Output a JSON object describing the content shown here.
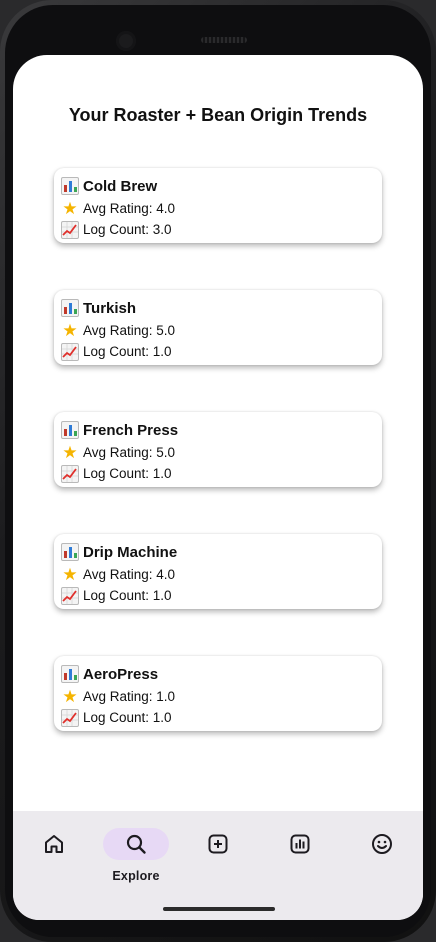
{
  "page": {
    "title": "Your Roaster + Bean Origin Trends"
  },
  "cards": [
    {
      "title": "Cold Brew",
      "rating_text": "Avg Rating: 4.0",
      "count_text": "Log Count: 3.0"
    },
    {
      "title": "Turkish",
      "rating_text": "Avg Rating: 5.0",
      "count_text": "Log Count: 1.0"
    },
    {
      "title": "French Press",
      "rating_text": "Avg Rating: 5.0",
      "count_text": "Log Count: 1.0"
    },
    {
      "title": "Drip Machine",
      "rating_text": "Avg Rating: 4.0",
      "count_text": "Log Count: 1.0"
    },
    {
      "title": "AeroPress",
      "rating_text": "Avg Rating: 1.0",
      "count_text": "Log Count: 1.0"
    }
  ],
  "icons": {
    "card_title": "bar-chart-icon",
    "rating": "star-icon",
    "count": "chart-increasing-icon"
  },
  "nav": {
    "items": [
      {
        "id": "home",
        "icon": "home-icon",
        "label": ""
      },
      {
        "id": "explore",
        "icon": "search-icon",
        "label": "Explore",
        "active": true
      },
      {
        "id": "add",
        "icon": "add-box-icon",
        "label": ""
      },
      {
        "id": "stats",
        "icon": "stats-icon",
        "label": ""
      },
      {
        "id": "profile",
        "icon": "smiley-icon",
        "label": ""
      }
    ]
  },
  "colors": {
    "background": "#ffffff",
    "navbar": "#eceaee",
    "active_pill": "#e7d9f5",
    "text": "#111111",
    "star": "#f5b400"
  }
}
